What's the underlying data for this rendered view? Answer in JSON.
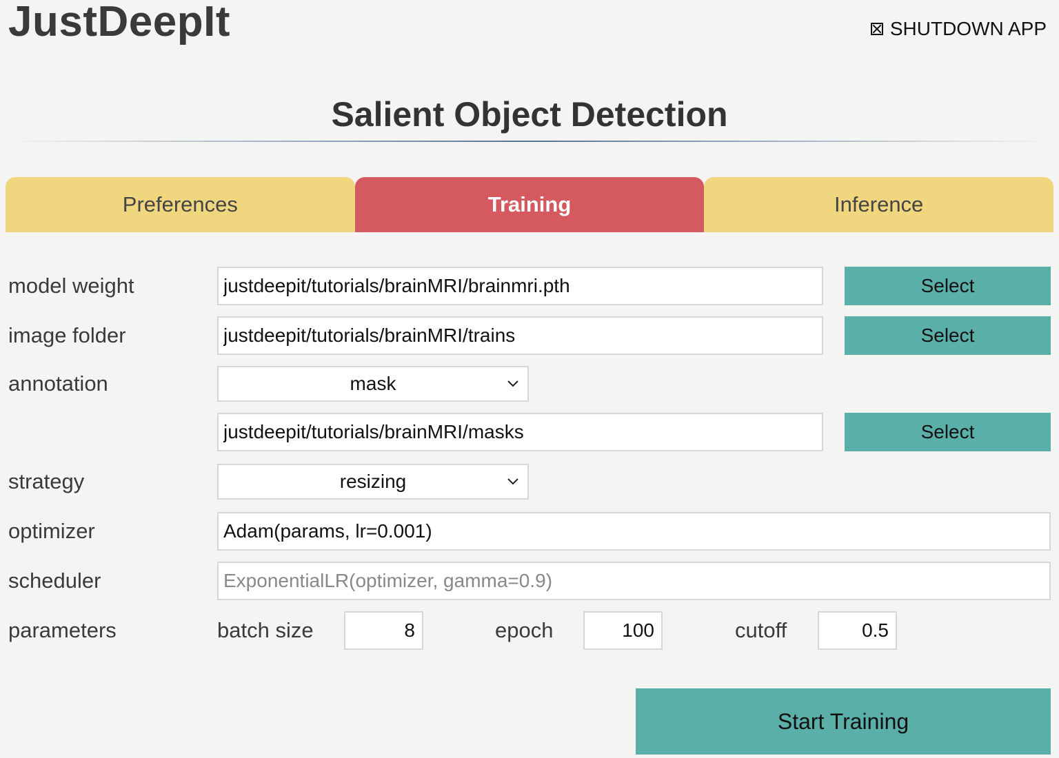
{
  "app": {
    "title": "JustDeepIt",
    "shutdown_label": "SHUTDOWN APP"
  },
  "module": {
    "title": "Salient Object Detection"
  },
  "tabs": [
    {
      "label": "Preferences",
      "active": false
    },
    {
      "label": "Training",
      "active": true
    },
    {
      "label": "Inference",
      "active": false
    }
  ],
  "form": {
    "model_weight": {
      "label": "model weight",
      "value": "justdeepit/tutorials/brainMRI/brainmri.pth",
      "button": "Select"
    },
    "image_folder": {
      "label": "image folder",
      "value": "justdeepit/tutorials/brainMRI/trains",
      "button": "Select"
    },
    "annotation": {
      "label": "annotation",
      "format": "mask",
      "value": "justdeepit/tutorials/brainMRI/masks",
      "button": "Select"
    },
    "strategy": {
      "label": "strategy",
      "value": "resizing"
    },
    "optimizer": {
      "label": "optimizer",
      "value": "Adam(params, lr=0.001)"
    },
    "scheduler": {
      "label": "scheduler",
      "placeholder": "ExponentialLR(optimizer, gamma=0.9)"
    },
    "parameters": {
      "label": "parameters",
      "batch_size_label": "batch size",
      "batch_size": "8",
      "epoch_label": "epoch",
      "epoch": "100",
      "cutoff_label": "cutoff",
      "cutoff": "0.5"
    }
  },
  "actions": {
    "start_training": "Start Training"
  },
  "colors": {
    "background": "#f4f4f2",
    "tab_inactive": "#f1d680",
    "tab_active": "#d45a5f",
    "button_teal": "#5aafa8"
  }
}
